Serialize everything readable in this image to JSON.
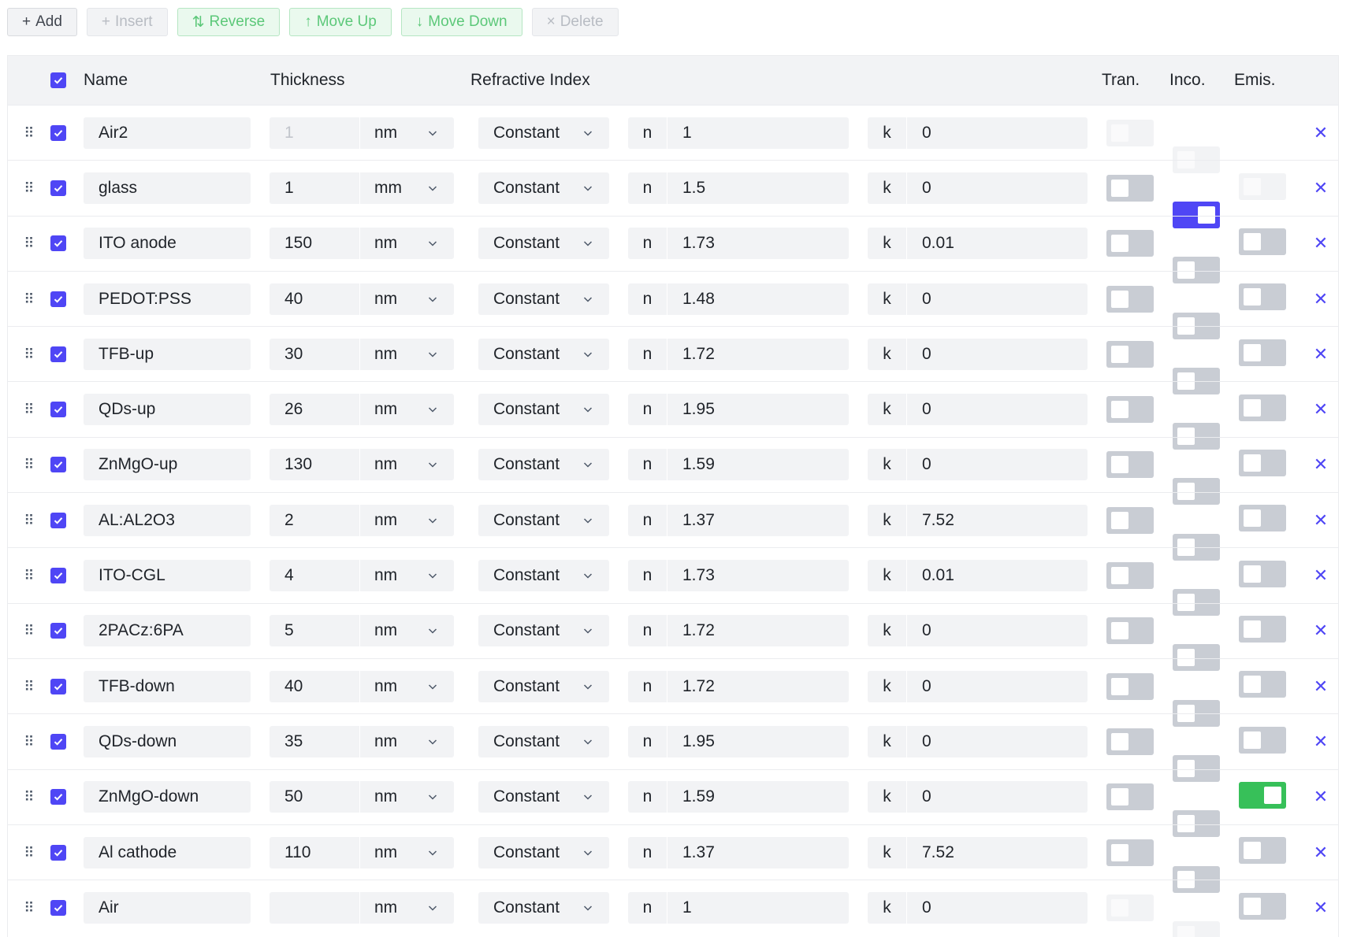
{
  "toolbar": {
    "add_label": "Add",
    "insert_label": "Insert",
    "reverse_label": "Reverse",
    "move_up_label": "Move Up",
    "move_down_label": "Move Down",
    "delete_label": "Delete"
  },
  "header": {
    "name": "Name",
    "thickness": "Thickness",
    "refractive_index": "Refractive Index",
    "tran": "Tran.",
    "inco": "Inco.",
    "emis": "Emis."
  },
  "colors": {
    "accent": "#4f46f5",
    "emis_on": "#37c059",
    "toolbar_green": "#5cc879"
  },
  "n_label": "n",
  "k_label": "k",
  "layers": [
    {
      "name": "Air2",
      "thickness": "1",
      "unit": "nm",
      "model": "Constant",
      "n": "1",
      "k": "0",
      "checked": true,
      "thickness_disabled": true,
      "tran": false,
      "inco": false,
      "emis": false,
      "toggles_disabled": true
    },
    {
      "name": "glass",
      "thickness": "1",
      "unit": "mm",
      "model": "Constant",
      "n": "1.5",
      "k": "0",
      "checked": true,
      "thickness_disabled": false,
      "tran": false,
      "inco": true,
      "emis": false,
      "toggles_disabled": false
    },
    {
      "name": "ITO anode",
      "thickness": "150",
      "unit": "nm",
      "model": "Constant",
      "n": "1.73",
      "k": "0.01",
      "checked": true,
      "thickness_disabled": false,
      "tran": false,
      "inco": false,
      "emis": false,
      "toggles_disabled": false
    },
    {
      "name": "PEDOT:PSS",
      "thickness": "40",
      "unit": "nm",
      "model": "Constant",
      "n": "1.48",
      "k": "0",
      "checked": true,
      "thickness_disabled": false,
      "tran": false,
      "inco": false,
      "emis": false,
      "toggles_disabled": false
    },
    {
      "name": "TFB-up",
      "thickness": "30",
      "unit": "nm",
      "model": "Constant",
      "n": "1.72",
      "k": "0",
      "checked": true,
      "thickness_disabled": false,
      "tran": false,
      "inco": false,
      "emis": false,
      "toggles_disabled": false
    },
    {
      "name": "QDs-up",
      "thickness": "26",
      "unit": "nm",
      "model": "Constant",
      "n": "1.95",
      "k": "0",
      "checked": true,
      "thickness_disabled": false,
      "tran": false,
      "inco": false,
      "emis": false,
      "toggles_disabled": false
    },
    {
      "name": "ZnMgO-up",
      "thickness": "130",
      "unit": "nm",
      "model": "Constant",
      "n": "1.59",
      "k": "0",
      "checked": true,
      "thickness_disabled": false,
      "tran": false,
      "inco": false,
      "emis": false,
      "toggles_disabled": false
    },
    {
      "name": "AL:AL2O3",
      "thickness": "2",
      "unit": "nm",
      "model": "Constant",
      "n": "1.37",
      "k": "7.52",
      "checked": true,
      "thickness_disabled": false,
      "tran": false,
      "inco": false,
      "emis": false,
      "toggles_disabled": false
    },
    {
      "name": "ITO-CGL",
      "thickness": "4",
      "unit": "nm",
      "model": "Constant",
      "n": "1.73",
      "k": "0.01",
      "checked": true,
      "thickness_disabled": false,
      "tran": false,
      "inco": false,
      "emis": false,
      "toggles_disabled": false
    },
    {
      "name": "2PACz:6PA",
      "thickness": "5",
      "unit": "nm",
      "model": "Constant",
      "n": "1.72",
      "k": "0",
      "checked": true,
      "thickness_disabled": false,
      "tran": false,
      "inco": false,
      "emis": false,
      "toggles_disabled": false
    },
    {
      "name": "TFB-down",
      "thickness": "40",
      "unit": "nm",
      "model": "Constant",
      "n": "1.72",
      "k": "0",
      "checked": true,
      "thickness_disabled": false,
      "tran": false,
      "inco": false,
      "emis": false,
      "toggles_disabled": false
    },
    {
      "name": "QDs-down",
      "thickness": "35",
      "unit": "nm",
      "model": "Constant",
      "n": "1.95",
      "k": "0",
      "checked": true,
      "thickness_disabled": false,
      "tran": false,
      "inco": false,
      "emis": true,
      "toggles_disabled": false
    },
    {
      "name": "ZnMgO-down",
      "thickness": "50",
      "unit": "nm",
      "model": "Constant",
      "n": "1.59",
      "k": "0",
      "checked": true,
      "thickness_disabled": false,
      "tran": false,
      "inco": false,
      "emis": false,
      "toggles_disabled": false
    },
    {
      "name": "Al cathode",
      "thickness": "110",
      "unit": "nm",
      "model": "Constant",
      "n": "1.37",
      "k": "7.52",
      "checked": true,
      "thickness_disabled": false,
      "tran": false,
      "inco": false,
      "emis": false,
      "toggles_disabled": false
    },
    {
      "name": "Air",
      "thickness": "",
      "unit": "nm",
      "model": "Constant",
      "n": "1",
      "k": "0",
      "checked": true,
      "thickness_disabled": false,
      "tran": false,
      "inco": false,
      "emis": false,
      "toggles_disabled": true
    }
  ]
}
